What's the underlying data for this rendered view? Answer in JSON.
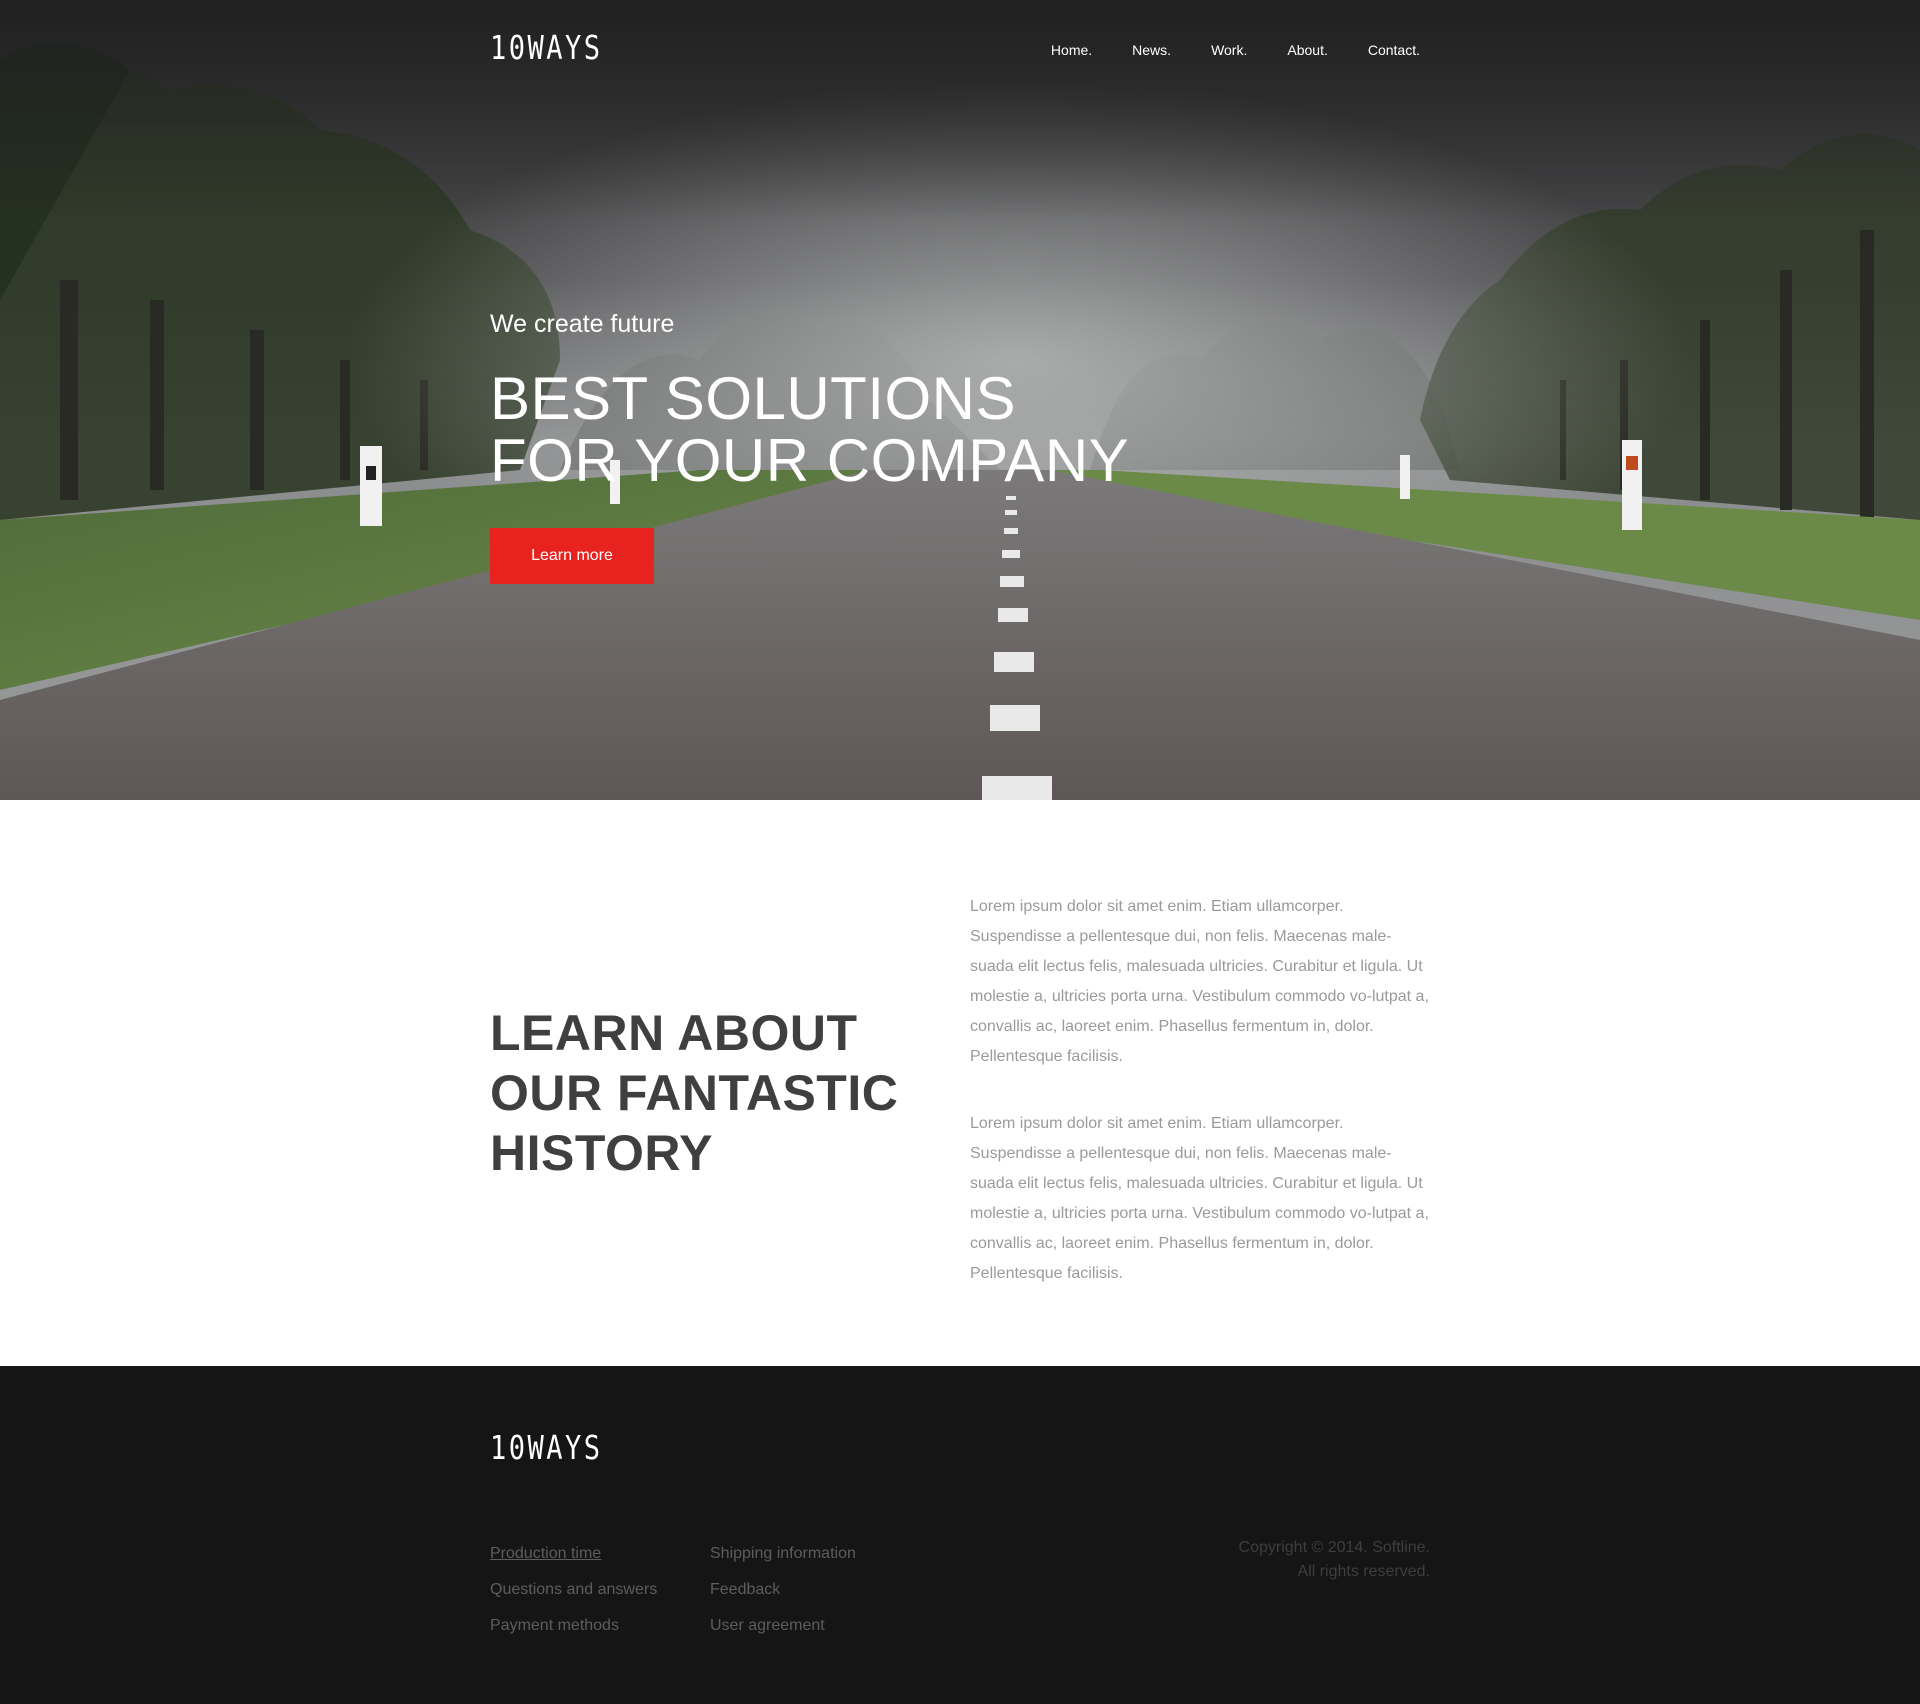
{
  "header": {
    "logo": "10WAYS",
    "nav": [
      {
        "label": "Home."
      },
      {
        "label": "News."
      },
      {
        "label": "Work."
      },
      {
        "label": "About."
      },
      {
        "label": "Contact."
      }
    ]
  },
  "hero": {
    "subtitle": "We create future",
    "title_line1": "BEST SOLUTIONS",
    "title_line2": "FOR YOUR COMPANY",
    "cta_label": "Learn more",
    "cta_color": "#e8221f"
  },
  "about": {
    "heading_line1": "LEARN ABOUT",
    "heading_line2": "OUR FANTASTIC",
    "heading_line3": "HISTORY",
    "paragraph1": "Lorem ipsum dolor sit amet enim. Etiam ullamcorper. Suspendisse a pellentesque dui, non felis. Maecenas male-suada elit lectus felis, malesuada ultricies. Curabitur et ligula. Ut molestie a, ultricies porta urna. Vestibulum commodo vo-lutpat a, convallis ac, laoreet enim. Phasellus fermentum in, dolor. Pellentesque facilisis.",
    "paragraph2": "Lorem ipsum dolor sit amet enim. Etiam ullamcorper. Suspendisse a pellentesque dui, non felis. Maecenas male-suada elit lectus felis, malesuada ultricies. Curabitur et ligula. Ut molestie a, ultricies porta urna. Vestibulum commodo vo-lutpat a, convallis ac, laoreet enim. Phasellus fermentum in, dolor. Pellentesque facilisis."
  },
  "footer": {
    "logo": "10WAYS",
    "col1": [
      "Production time",
      "Questions and answers",
      "Payment methods"
    ],
    "col2": [
      "Shipping information",
      "Feedback",
      "User agreement"
    ],
    "copyright_line1": "Copyright © 2014. Softline.",
    "copyright_line2": "All rights reserved."
  }
}
